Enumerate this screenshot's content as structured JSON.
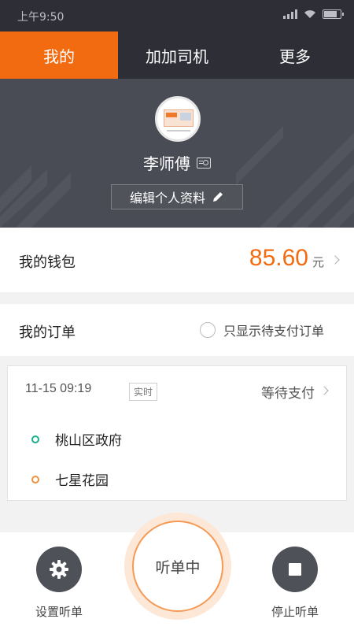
{
  "status_bar": {
    "time": "上午9:50"
  },
  "tabs": [
    {
      "label": "我的",
      "active": true
    },
    {
      "label": "加加司机",
      "active": false
    },
    {
      "label": "更多",
      "active": false
    }
  ],
  "profile": {
    "name": "李师傅",
    "edit_label": "编辑个人资料"
  },
  "wallet": {
    "label": "我的钱包",
    "amount": "85.60",
    "unit": "元"
  },
  "orders": {
    "label": "我的订单",
    "filter_label": "只显示待支付订单"
  },
  "order_card": {
    "time": "11-15 09:19",
    "type": "实时",
    "status": "等待支付",
    "start": "桃山区政府",
    "end": "七星花园"
  },
  "bottom_bar": {
    "settings_label": "设置听单",
    "listening_label": "听单中",
    "stop_label": "停止听单"
  },
  "colors": {
    "accent": "#f36b10",
    "header_dark": "#2e2f36",
    "profile_bg": "#4a4c55",
    "start_dot": "#19b08c",
    "end_dot": "#f0913f"
  }
}
